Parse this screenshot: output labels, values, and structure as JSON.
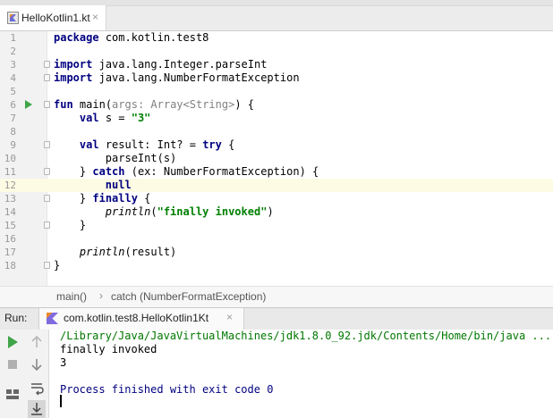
{
  "editor_tab": {
    "filename": "HelloKotlin1.kt",
    "close": "×",
    "icon": "kotlin-file-icon"
  },
  "editor": {
    "lines": [
      {
        "n": "1"
      },
      {
        "n": "2"
      },
      {
        "n": "3"
      },
      {
        "n": "4"
      },
      {
        "n": "5"
      },
      {
        "n": "6"
      },
      {
        "n": "7"
      },
      {
        "n": "8"
      },
      {
        "n": "9"
      },
      {
        "n": "10"
      },
      {
        "n": "11"
      },
      {
        "n": "12"
      },
      {
        "n": "13"
      },
      {
        "n": "14"
      },
      {
        "n": "15"
      },
      {
        "n": "16"
      },
      {
        "n": "17"
      },
      {
        "n": "18"
      }
    ],
    "tok": {
      "package_kw": "package",
      "package_name": "com.kotlin.test8",
      "import_kw": "import",
      "import1": "java.lang.Integer.parseInt",
      "import2": "java.lang.NumberFormatException",
      "fun_kw": "fun",
      "fun_name": "main(",
      "param_hint": "args: Array<String>",
      "fun_rest": ") {",
      "val_kw": "val",
      "s_decl": "s = ",
      "s_value": "\"3\"",
      "result_decl": "result: Int? = ",
      "try_kw": "try",
      "brace_open": " {",
      "parse_call": "parseInt(s)",
      "close_brace": "}",
      "catch_kw": "catch",
      "catch_rest": " (ex: NumberFormatException) {",
      "null_kw": "null",
      "finally_kw": "finally",
      "println": "println",
      "open_paren": "(",
      "finally_str": "\"finally invoked\"",
      "close_paren": ")",
      "print_result": "(result)"
    },
    "current_line": "12"
  },
  "breadcrumb": {
    "item1": "main()",
    "sep": "›",
    "item2": "catch (NumberFormatException)"
  },
  "run_panel": {
    "label": "Run:",
    "tab": "com.kotlin.test8.HelloKotlin1Kt",
    "close": "×",
    "console": [
      "/Library/Java/JavaVirtualMachines/jdk1.8.0_92.jdk/Contents/Home/bin/java ...",
      "finally invoked",
      "3",
      "",
      "Process finished with exit code 0"
    ]
  },
  "toolbar_icons": [
    "rerun-icon",
    "up-arrow-icon",
    "stop-icon",
    "down-arrow-icon",
    "soft-wrap-icon",
    "layout-icon",
    "scroll-to-end-icon"
  ],
  "colors": {
    "keyword": "#000080",
    "string": "#008000",
    "hint": "#808080",
    "run_green": "#3fa548",
    "current_line": "#fdfbe3"
  }
}
